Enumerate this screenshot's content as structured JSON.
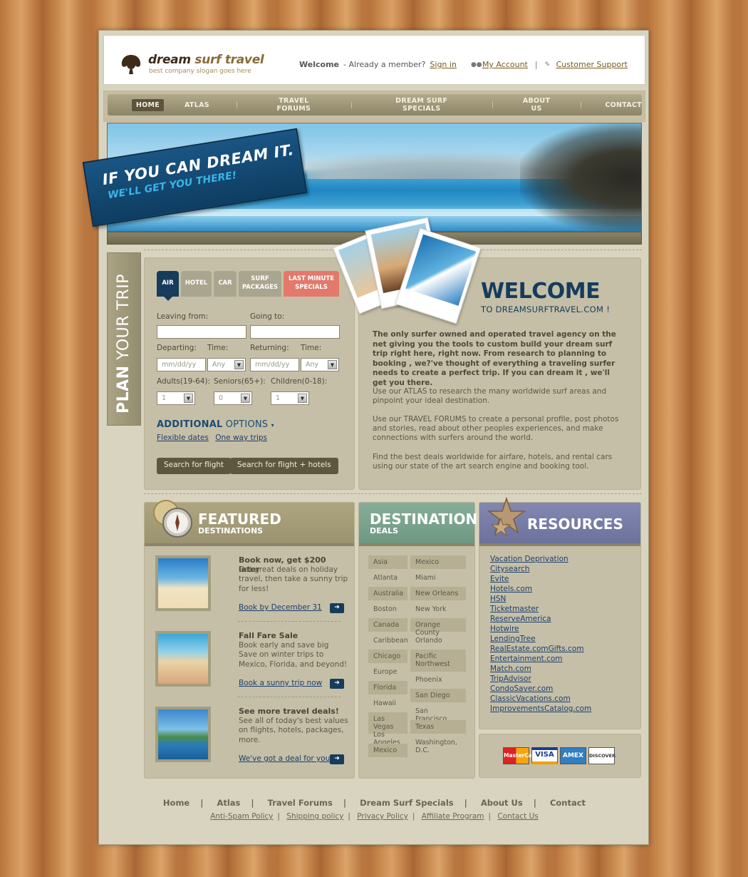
{
  "header": {
    "logo_dream": "dream",
    "logo_surf_travel": "surf travel",
    "slogan": "best company slogan goes here",
    "welcome": "Welcome",
    "already_member": "- Already a member?",
    "sign_in": "Sign in",
    "my_account": "My Account",
    "customer_support": "Customer Support"
  },
  "nav": {
    "items": [
      "HOME",
      "ATLAS",
      "TRAVEL FORUMS",
      "DREAM SURF SPECIALS",
      "ABOUT US",
      "CONTACT"
    ],
    "active": "HOME"
  },
  "banner": {
    "line1": "IF YOU CAN DREAM IT.",
    "line2": "WE'LL GET YOU THERE!"
  },
  "plan": {
    "title_bold": "PLAN",
    "title_rest": " YOUR TRIP",
    "tabs": {
      "air": "AIR",
      "hotel": "HOTEL",
      "car": "CAR",
      "surf_line1": "SURF",
      "surf_line2": "PACKAGES",
      "last_line1": "LAST MINUTE",
      "last_line2": "SPECIALS"
    },
    "leaving_from": "Leaving from:",
    "going_to": "Going to:",
    "departing": "Departing:",
    "time": "Time:",
    "returning": "Returning:",
    "date_placeholder": "mm/dd/yy",
    "time_value": "Any",
    "adults": "Adults(19-64):",
    "seniors": "Seniors(65+):",
    "children": "Children(0-18):",
    "adults_value": "1",
    "seniors_value": "0",
    "children_value": "1",
    "additional_bold": "ADDITIONAL",
    "additional_rest": " OPTIONS",
    "flexible_dates": "Flexible dates",
    "one_way": "One way trips",
    "search_flight": "Search for flight",
    "search_flight_hotels": "Search for flight + hotels"
  },
  "welcome": {
    "title": "WELCOME",
    "subtitle": "TO DREAMSURFTRAVEL.COM !",
    "intro": "The only surfer owned and operated travel agency on the net giving you the tools to custom build your dream surf trip right here, right now. From research to planning to booking , we?'ve thought of everything a traveling surfer needs to create a perfect trip.  If you can dream it , we'll get you there.",
    "p1": "Use our ATLAS to research the many worldwide surf areas and pinpoint your ideal destination.",
    "p2": "Use our TRAVEL FORUMS to create a personal profile, post photos and stories, read about other peoples experiences, and make connections with surfers around the world.",
    "p3": "Find the best deals worldwide for airfare, hotels, and rental cars using our state of the art search engine and booking tool."
  },
  "featured": {
    "title": "FEATURED",
    "subtitle": "DESTINATIONS",
    "items": [
      {
        "title": "Book now, get $200 later",
        "desc": "Get great deals on holiday travel, then take a sunny trip for less!",
        "link": "Book by December 31"
      },
      {
        "title": "Fall Fare Sale",
        "desc": "Book early and save big Save on winter trips to Mexico, Florida, and beyond!",
        "link": "Book a sunny trip now"
      },
      {
        "title": "See more travel deals!",
        "desc": "See all of today's best values on flights, hotels, packages, more.",
        "link": "We've got a deal for you"
      }
    ]
  },
  "deals": {
    "title": "DESTINATION",
    "subtitle": "DEALS",
    "left": [
      "Asia",
      "Atlanta",
      "Australia",
      "Boston",
      "Canada",
      "Caribbean",
      "Chicago",
      "Europe",
      "Florida",
      "Hawaii",
      "Las Vegas",
      "Los Angeles",
      "Mexico"
    ],
    "right": [
      "Mexico",
      "Miami",
      "New Orleans",
      "New York",
      "Orange County",
      "Orlando",
      "Pacific Northwest",
      "Phoenix",
      "San Diego",
      "San Francisco",
      "Texas",
      "Washington, D.C."
    ]
  },
  "resources": {
    "title": "RESOURCES",
    "links": [
      "Vacation Deprivation",
      "Citysearch",
      "Evite",
      "Hotels.com",
      "HSN",
      "Ticketmaster",
      "ReserveAmerica",
      "Hotwire",
      "LendingTree",
      "RealEstate.comGifts.com",
      "Entertainment.com",
      "Match.com",
      "TripAdvisor",
      "CondoSaver.com",
      "ClassicVacations.com",
      "ImprovementsCatalog.com"
    ]
  },
  "cards": [
    "MasterCard",
    "VISA",
    "AMEX",
    "DISCOVER"
  ],
  "footer": {
    "nav": [
      "Home",
      "Atlas",
      "Travel Forums",
      "Dream Surf Specials",
      "About Us",
      "Contact"
    ],
    "links": [
      "Anti-Spam Policy",
      "Shipping policy",
      "Privacy Policy",
      "Affiliate Program",
      "Contact Us"
    ]
  },
  "colors": {
    "navy": "#163c5c",
    "khaki": "#a49874",
    "teal": "#77a08a",
    "slate": "#7076a0",
    "coral": "#e2796a"
  }
}
